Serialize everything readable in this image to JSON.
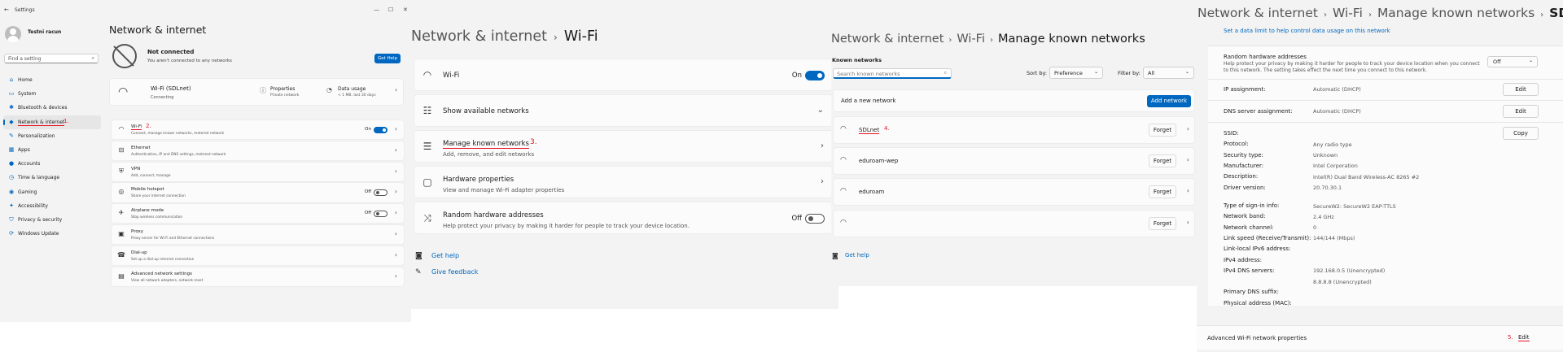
{
  "panel1": {
    "window_title": "Settings",
    "user_name": "Testni racun",
    "search_placeholder": "Find a setting",
    "nav": [
      {
        "label": "Home",
        "icon": "home-icon",
        "glyph": "⌂"
      },
      {
        "label": "System",
        "icon": "system-icon",
        "glyph": "▭"
      },
      {
        "label": "Bluetooth & devices",
        "icon": "bluetooth-icon",
        "glyph": "✱"
      },
      {
        "label": "Network & internet",
        "icon": "network-icon",
        "glyph": "◆"
      },
      {
        "label": "Personalization",
        "icon": "brush-icon",
        "glyph": "✎"
      },
      {
        "label": "Apps",
        "icon": "apps-icon",
        "glyph": "▦"
      },
      {
        "label": "Accounts",
        "icon": "accounts-icon",
        "glyph": "●"
      },
      {
        "label": "Time & language",
        "icon": "clock-icon",
        "glyph": "◷"
      },
      {
        "label": "Gaming",
        "icon": "gaming-icon",
        "glyph": "◉"
      },
      {
        "label": "Accessibility",
        "icon": "accessibility-icon",
        "glyph": "✦"
      },
      {
        "label": "Privacy & security",
        "icon": "shield-icon",
        "glyph": "⛉"
      },
      {
        "label": "Windows Update",
        "icon": "update-icon",
        "glyph": "⟳"
      }
    ],
    "step1": "1.",
    "title": "Network & internet",
    "status_title": "Not connected",
    "status_sub": "You aren't connected to any networks",
    "get_help": "Get Help",
    "wifi_name": "Wi-Fi (SDLnet)",
    "wifi_state": "Connecting",
    "properties": "Properties",
    "properties_sub": "Private network",
    "data_usage": "Data usage",
    "data_usage_sub": "< 1 MB, last 30 days",
    "rows": [
      {
        "title": "Wi-Fi",
        "sub": "Connect, manage known networks, metered network",
        "toggle": "On",
        "icon": "wifi-icon",
        "glyph": "◠"
      },
      {
        "title": "Ethernet",
        "sub": "Authentication, IP and DNS settings, metered network",
        "toggle": "",
        "icon": "ethernet-icon",
        "glyph": "⊟"
      },
      {
        "title": "VPN",
        "sub": "Add, connect, manage",
        "toggle": "",
        "icon": "vpn-icon",
        "glyph": "⛨"
      },
      {
        "title": "Mobile hotspot",
        "sub": "Share your internet connection",
        "toggle": "Off",
        "icon": "hotspot-icon",
        "glyph": "◎"
      },
      {
        "title": "Airplane mode",
        "sub": "Stop wireless communication",
        "toggle": "Off",
        "icon": "airplane-icon",
        "glyph": "✈"
      },
      {
        "title": "Proxy",
        "sub": "Proxy server for Wi-Fi and Ethernet connections",
        "toggle": "",
        "icon": "proxy-icon",
        "glyph": "▣"
      },
      {
        "title": "Dial-up",
        "sub": "Set up a dial-up internet connection",
        "toggle": "",
        "icon": "dialup-icon",
        "glyph": "☎"
      },
      {
        "title": "Advanced network settings",
        "sub": "View all network adapters, network reset",
        "toggle": "",
        "icon": "adapter-icon",
        "glyph": "▤"
      }
    ],
    "step2": "2."
  },
  "panel2": {
    "crumb1": "Network & internet",
    "crumb2": "Wi-Fi",
    "wifi_label": "Wi-Fi",
    "wifi_toggle": "On",
    "show_networks": "Show available networks",
    "manage_known": "Manage known networks",
    "manage_known_sub": "Add, remove, and edit networks",
    "step3": "3.",
    "hw_props": "Hardware properties",
    "hw_props_sub": "View and manage Wi-Fi adapter properties",
    "random_hw": "Random hardware addresses",
    "random_hw_sub": "Help protect your privacy by making it harder for people to track your device location.",
    "random_toggle": "Off",
    "get_help": "Get help",
    "give_feedback": "Give feedback"
  },
  "panel3": {
    "crumb1": "Network & internet",
    "crumb2": "Wi-Fi",
    "crumb3": "Manage known networks",
    "known_label": "Known networks",
    "search_placeholder": "Search known networks",
    "sort_label": "Sort by:",
    "sort_value": "Preference",
    "filter_label": "Filter by:",
    "filter_value": "All",
    "add_label": "Add a new network",
    "add_button": "Add network",
    "networks": [
      {
        "name": "SDLnet",
        "step": "4."
      },
      {
        "name": "eduroam-wep",
        "step": ""
      },
      {
        "name": "eduroam",
        "step": ""
      },
      {
        "name": "",
        "step": ""
      }
    ],
    "forget": "Forget",
    "get_help": "Get help"
  },
  "panel4": {
    "crumb1": "Network & internet",
    "crumb2": "Wi-Fi",
    "crumb3": "Manage known networks",
    "crumb4": "SDLnet",
    "data_limit_link": "Set a data limit to help control data usage on this network",
    "rha_title": "Random hardware addresses",
    "rha_desc": "Help protect your privacy by making it harder for people to track your device location when you connect to this network. The setting takes effect the next time you connect to this network.",
    "rha_value": "Off",
    "ip_assignment_label": "IP assignment:",
    "ip_assignment_value": "Automatic (DHCP)",
    "dns_assignment_label": "DNS server assignment:",
    "dns_assignment_value": "Automatic (DHCP)",
    "edit": "Edit",
    "copy": "Copy",
    "props": [
      {
        "label": "SSID:",
        "value": ""
      },
      {
        "label": "Protocol:",
        "value": "Any radio type"
      },
      {
        "label": "Security type:",
        "value": "Unknown"
      },
      {
        "label": "Manufacturer:",
        "value": "Intel Corporation"
      },
      {
        "label": "Description:",
        "value": "Intel(R) Dual Band Wireless-AC 8265 #2"
      },
      {
        "label": "Driver version:",
        "value": "20.70.30.1"
      }
    ],
    "props2": [
      {
        "label": "Type of sign-in info:",
        "value": "SecureW2: SecureW2 EAP-TTLS"
      },
      {
        "label": "Network band:",
        "value": "2.4 GHz"
      },
      {
        "label": "Network channel:",
        "value": "0"
      },
      {
        "label": "Link speed (Receive/Transmit):",
        "value": "144/144 (Mbps)"
      },
      {
        "label": "Link-local IPv6 address:",
        "value": ""
      },
      {
        "label": "IPv4 address:",
        "value": ""
      },
      {
        "label": "IPv4 DNS servers:",
        "value": "192.168.0.5 (Unencrypted)"
      },
      {
        "label": "",
        "value": "8.8.8.8 (Unencrypted)"
      },
      {
        "label": "Primary DNS suffix:",
        "value": ""
      },
      {
        "label": "Physical address (MAC):",
        "value": ""
      }
    ],
    "advanced_label": "Advanced Wi-Fi network properties",
    "step5": "5.",
    "advanced_edit": "Edit"
  }
}
